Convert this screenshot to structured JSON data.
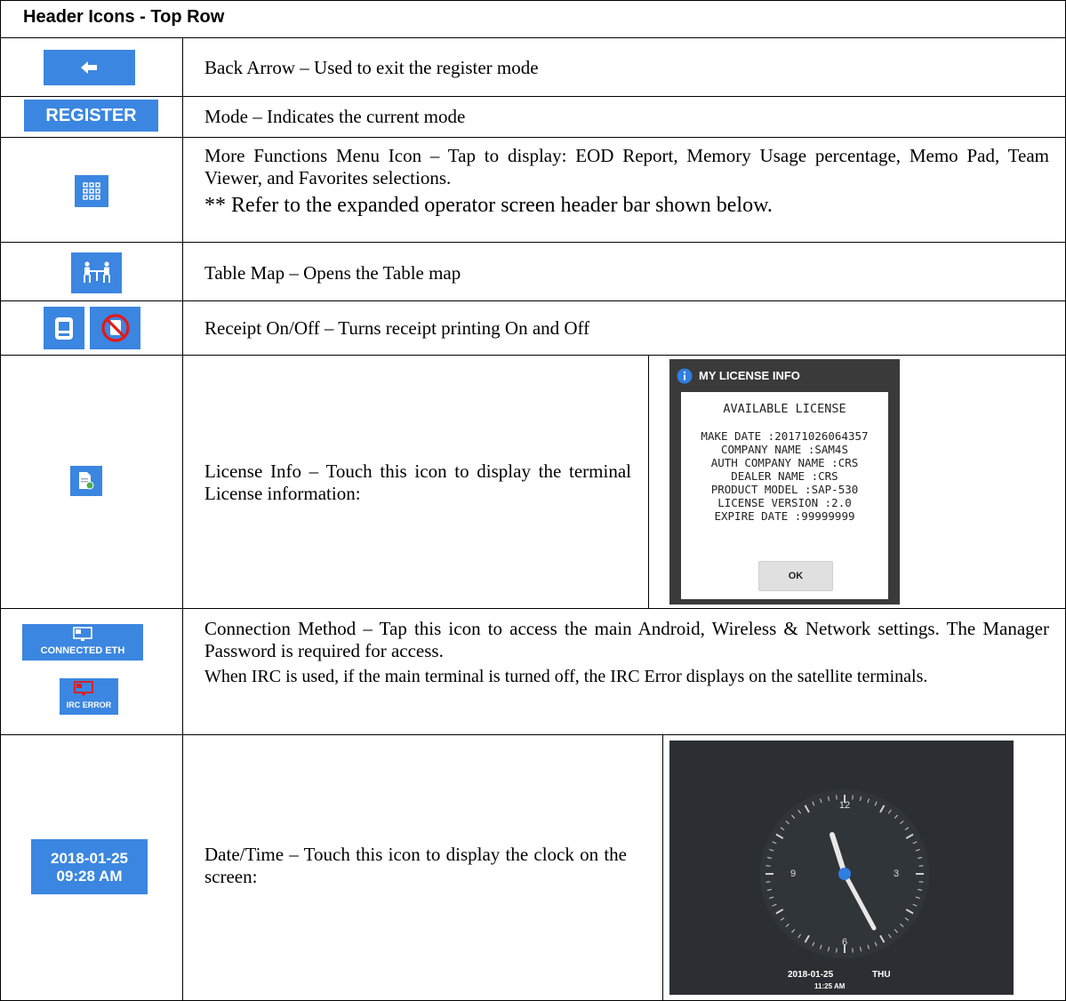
{
  "header": {
    "title": "Header Icons - Top Row"
  },
  "rows": {
    "back": {
      "desc": "Back Arrow – Used to exit the register mode"
    },
    "mode": {
      "badge": "REGISTER",
      "desc": "Mode – Indicates the current mode"
    },
    "more": {
      "desc_1": "More Functions Menu Icon – Tap to display: EOD Report, Memory Usage percentage, Memo Pad, Team Viewer, and Favorites selections.",
      "desc_2": "** Refer to the expanded operator screen header bar shown below."
    },
    "table_map": {
      "desc": "Table Map – Opens the Table map"
    },
    "receipt": {
      "desc": "Receipt On/Off – Turns receipt printing On and Off"
    },
    "license": {
      "desc": "License Info – Touch this icon to display the terminal License information:",
      "dialog_title": "MY LICENSE INFO",
      "lines": [
        "AVAILABLE LICENSE",
        "",
        "MAKE DATE :20171026064357",
        "COMPANY NAME :SAM4S",
        "AUTH COMPANY NAME :CRS",
        "DEALER NAME :CRS",
        "PRODUCT MODEL :SAP-530",
        "LICENSE VERSION :2.0",
        "EXPIRE DATE :99999999"
      ],
      "ok": "OK"
    },
    "connection": {
      "badge_eth": "CONNECTED ETH",
      "badge_irc": "IRC ERROR",
      "desc_1": "Connection Method – Tap this icon to access the main Android, Wireless & Network settings. The Manager Password is required for access.",
      "desc_2": "When IRC is used, if the main terminal is turned off, the IRC Error displays on the satellite terminals."
    },
    "datetime": {
      "badge_date": "2018-01-25",
      "badge_time": "09:28 AM",
      "desc": "Date/Time – Touch this icon to display the clock on the screen:",
      "clock_12": "12",
      "clock_3": "3",
      "clock_6": "6",
      "clock_9": "9",
      "clock_date": "2018-01-25",
      "clock_day": "THU",
      "clock_time": "11:25 AM"
    }
  }
}
